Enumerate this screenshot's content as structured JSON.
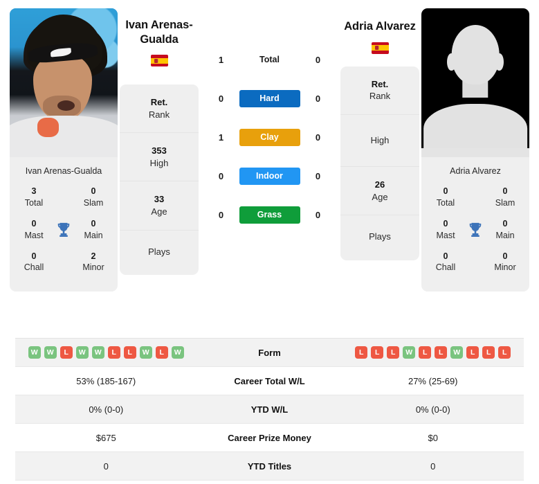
{
  "players": {
    "left": {
      "name": "Ivan Arenas-Gualda",
      "name_display": "Ivan Arenas-\nGualda",
      "card_name": "Ivan Arenas-Gualda",
      "flag": "spain-flag",
      "titles": [
        {
          "value": "3",
          "label": "Total"
        },
        {
          "value": "0",
          "label": "Slam"
        },
        {
          "value": "0",
          "label": "Mast"
        },
        {
          "value": "0",
          "label": "Main"
        },
        {
          "value": "0",
          "label": "Chall"
        },
        {
          "value": "2",
          "label": "Minor"
        }
      ],
      "rank": {
        "current_value": "Ret.",
        "current_label": "Rank",
        "high_value": "353",
        "high_label": "High",
        "age_value": "33",
        "age_label": "Age",
        "plays_value": "",
        "plays_label": "Plays"
      },
      "form": [
        "W",
        "W",
        "L",
        "W",
        "W",
        "L",
        "L",
        "W",
        "L",
        "W"
      ],
      "career_total_wl": "53% (185-167)",
      "ytd_wl": "0% (0-0)",
      "career_prize_money": "$675",
      "ytd_titles": "0",
      "surface_values": {
        "total": "1",
        "hard": "0",
        "clay": "1",
        "indoor": "0",
        "grass": "0"
      }
    },
    "right": {
      "name": "Adria Alvarez",
      "name_display": "Adria Alvarez",
      "card_name": "Adria Alvarez",
      "flag": "spain-flag",
      "titles": [
        {
          "value": "0",
          "label": "Total"
        },
        {
          "value": "0",
          "label": "Slam"
        },
        {
          "value": "0",
          "label": "Mast"
        },
        {
          "value": "0",
          "label": "Main"
        },
        {
          "value": "0",
          "label": "Chall"
        },
        {
          "value": "0",
          "label": "Minor"
        }
      ],
      "rank": {
        "current_value": "Ret.",
        "current_label": "Rank",
        "high_value": "",
        "high_label": "High",
        "age_value": "26",
        "age_label": "Age",
        "plays_value": "",
        "plays_label": "Plays"
      },
      "form": [
        "L",
        "L",
        "L",
        "W",
        "L",
        "L",
        "W",
        "L",
        "L",
        "L"
      ],
      "career_total_wl": "27% (25-69)",
      "ytd_wl": "0% (0-0)",
      "career_prize_money": "$0",
      "ytd_titles": "0",
      "surface_values": {
        "total": "0",
        "hard": "0",
        "clay": "0",
        "indoor": "0",
        "grass": "0"
      }
    }
  },
  "surfaces": [
    {
      "key": "total",
      "label": "Total",
      "color": "transparent",
      "plain": true
    },
    {
      "key": "hard",
      "label": "Hard",
      "color": "#0b6bc0",
      "plain": false
    },
    {
      "key": "clay",
      "label": "Clay",
      "color": "#e8a00c",
      "plain": false
    },
    {
      "key": "indoor",
      "label": "Indoor",
      "color": "#2196f3",
      "plain": false
    },
    {
      "key": "grass",
      "label": "Grass",
      "color": "#0f9d3a",
      "plain": false
    }
  ],
  "table_rows": [
    {
      "label": "Form",
      "type": "form"
    },
    {
      "label": "Career Total W/L",
      "type": "text",
      "key": "career_total_wl"
    },
    {
      "label": "YTD W/L",
      "type": "text",
      "key": "ytd_wl"
    },
    {
      "label": "Career Prize Money",
      "type": "text",
      "key": "career_prize_money"
    },
    {
      "label": "YTD Titles",
      "type": "text",
      "key": "ytd_titles"
    }
  ],
  "colors": {
    "hard": "#0b6bc0",
    "clay": "#e8a00c",
    "indoor": "#2196f3",
    "grass": "#0f9d3a",
    "win_badge": "#7ac47f",
    "loss_badge": "#ee5843",
    "trophy": "#3c73b9",
    "card_bg": "#efefef"
  }
}
